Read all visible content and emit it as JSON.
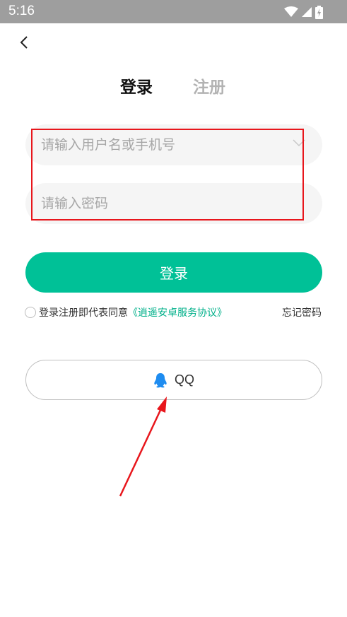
{
  "status_bar": {
    "time": "5:16"
  },
  "icons": {
    "back": "chevron-left-icon",
    "wifi": "wifi-icon",
    "signal": "signal-icon",
    "battery": "battery-charging-icon",
    "dropdown": "chevron-down-icon",
    "qq": "qq-penguin-icon"
  },
  "tabs": {
    "login": "登录",
    "register": "注册"
  },
  "form": {
    "username_placeholder": "请输入用户名或手机号",
    "username_value": "",
    "password_placeholder": "请输入密码",
    "password_value": "",
    "login_button": "登录"
  },
  "agreement": {
    "prefix": "登录注册即代表同意",
    "link": "《逍遥安卓服务协议》",
    "forgot_password": "忘记密码"
  },
  "social": {
    "qq_label": "QQ"
  },
  "colors": {
    "accent": "#00c197",
    "link": "#00b08a",
    "annotation_red": "#e8161c",
    "qq_blue": "#1e8cf0",
    "status_bar": "#9e9e9e"
  }
}
